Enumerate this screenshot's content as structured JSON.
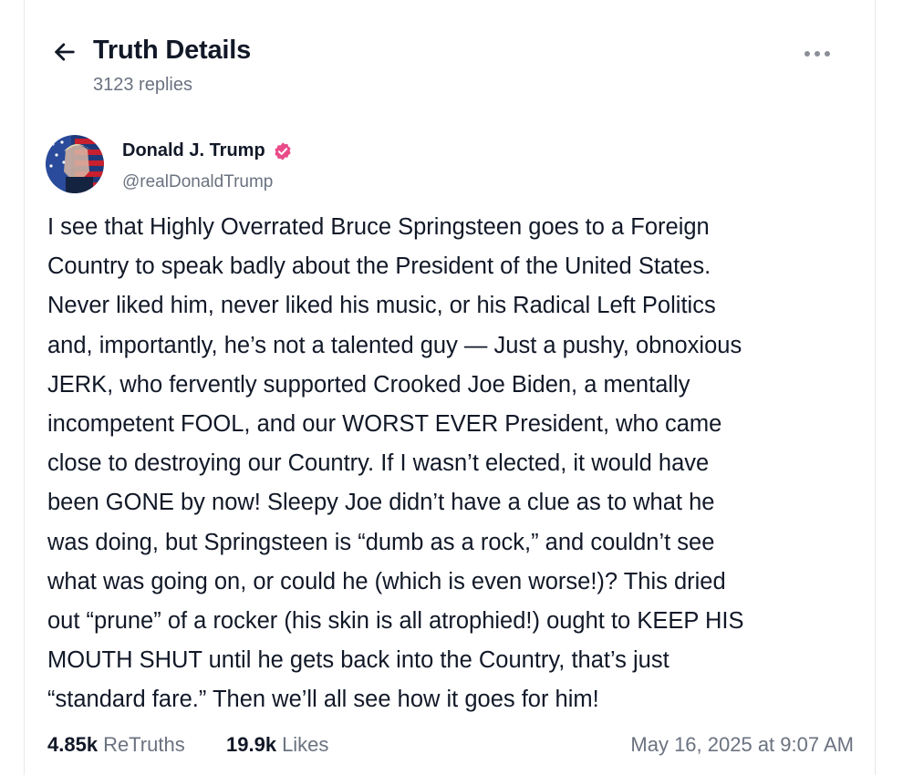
{
  "header": {
    "back_icon": "arrow-left-icon",
    "title": "Truth Details",
    "replies": "3123 replies",
    "more_icon": "more-horizontal-icon"
  },
  "author": {
    "name": "Donald J. Trump",
    "handle": "@realDonaldTrump",
    "verified_icon": "verified-badge-icon",
    "verified_color": "#ea4c89"
  },
  "post": {
    "lines": [
      "I see that Highly Overrated Bruce Springsteen goes to a Foreign",
      "Country to speak badly about the President of the United States.",
      "Never liked him, never liked his music, or his Radical Left Politics",
      "and, importantly, he’s not a talented guy — Just a pushy, obnoxious",
      "JERK, who fervently supported Crooked Joe Biden, a mentally",
      "incompetent FOOL, and our WORST EVER President, who came",
      "close to destroying our Country. If I wasn’t elected, it would have",
      "been GONE by now! Sleepy Joe didn’t have a clue as to what he",
      "was doing, but Springsteen is “dumb as a rock,” and couldn’t see",
      "what was going on, or could he (which is even worse!)? This dried",
      "out “prune” of a rocker (his skin is all atrophied!) ought to KEEP HIS",
      "MOUTH SHUT until he gets back into the Country, that’s just",
      "“standard fare.” Then we’ll all see how it goes for him!"
    ]
  },
  "stats": {
    "retruths_count": "4.85k",
    "retruths_label": "ReTruths",
    "likes_count": "19.9k",
    "likes_label": "Likes",
    "timestamp": "May 16, 2025 at 9:07 AM"
  }
}
